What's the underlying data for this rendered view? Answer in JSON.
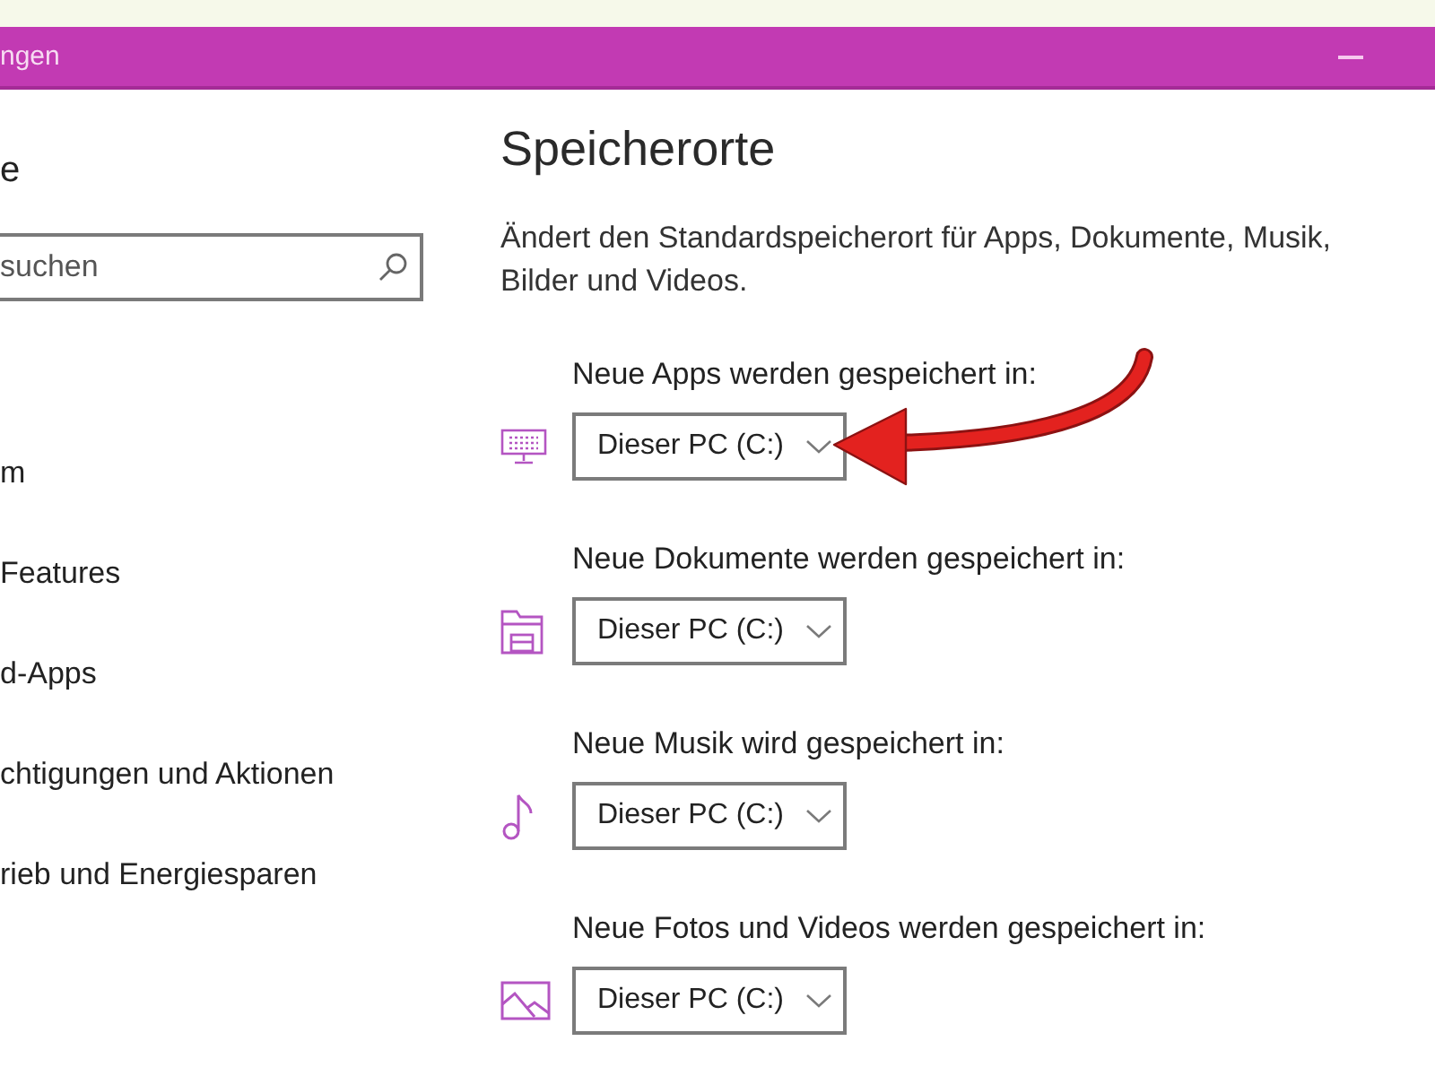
{
  "window": {
    "title": "ngen"
  },
  "sidebar": {
    "header": "e",
    "search": {
      "placeholder": "suchen"
    },
    "items": [
      {
        "label": "m"
      },
      {
        "label": "Features"
      },
      {
        "label": "d-Apps"
      },
      {
        "label": "chtigungen und Aktionen"
      },
      {
        "label": "rieb und Energiesparen"
      }
    ]
  },
  "page": {
    "title": "Speicherorte",
    "description": "Ändert den Standardspeicherort für Apps, Dokumente, Musik, Bilder und Videos.",
    "locations": [
      {
        "kind": "apps",
        "label": "Neue Apps werden gespeichert in:",
        "value": "Dieser PC (C:)",
        "pointed_at": true
      },
      {
        "kind": "documents",
        "label": "Neue Dokumente werden gespeichert in:",
        "value": "Dieser PC (C:)",
        "pointed_at": false
      },
      {
        "kind": "music",
        "label": "Neue Musik wird gespeichert in:",
        "value": "Dieser PC (C:)",
        "pointed_at": false
      },
      {
        "kind": "photos",
        "label": "Neue Fotos und Videos werden gespeichert in:",
        "value": "Dieser PC (C:)",
        "pointed_at": false
      }
    ]
  }
}
